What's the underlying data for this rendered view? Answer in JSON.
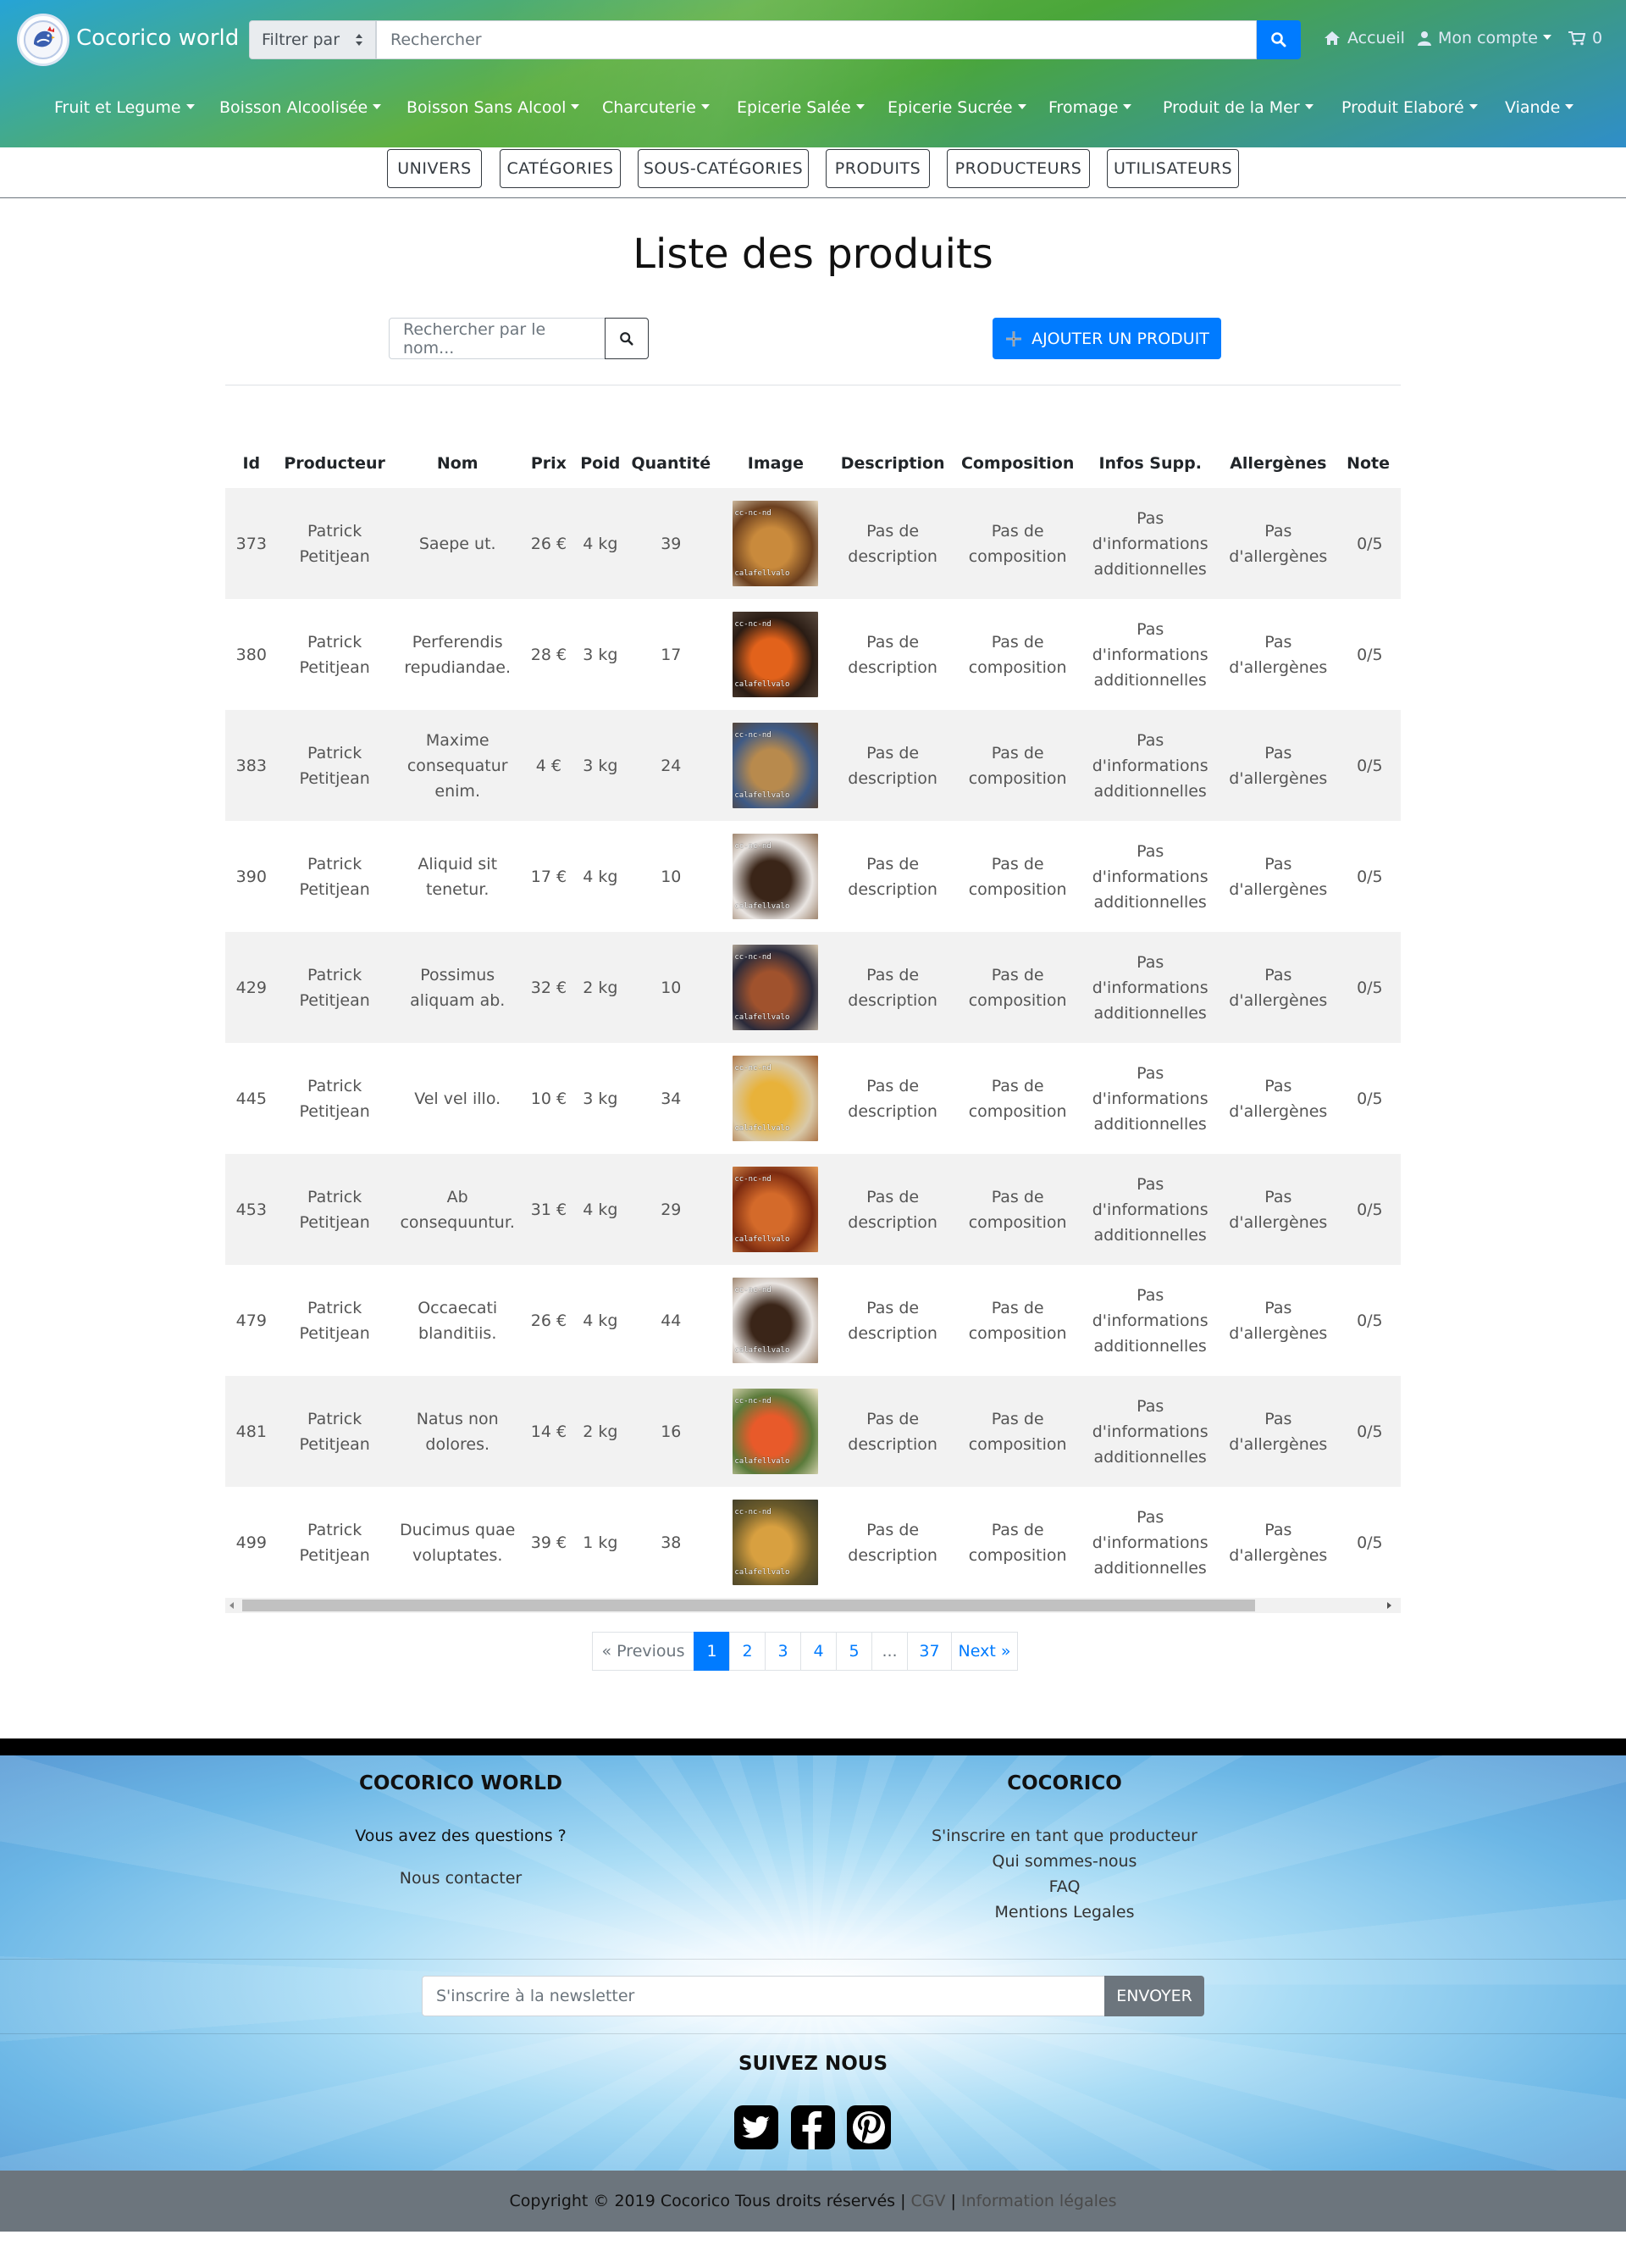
{
  "header": {
    "brand": "Cocorico world",
    "filter_label": "Filtrer par",
    "search_placeholder": "Rechercher",
    "home_label": "Accueil",
    "account_label": "Mon compte",
    "cart_count": "0",
    "categories": [
      "Fruit et Legume",
      "Boisson Alcoolisée",
      "Boisson Sans Alcool",
      "Charcuterie",
      "Epicerie Salée",
      "Epicerie Sucrée",
      "Fromage",
      "Produit de la Mer",
      "Produit Elaboré",
      "Viande"
    ]
  },
  "admin_nav": [
    "UNIVERS",
    "CATÉGORIES",
    "SOUS-CATÉGORIES",
    "PRODUITS",
    "PRODUCTEURS",
    "UTILISATEURS"
  ],
  "page": {
    "title": "Liste des produits",
    "name_search_placeholder": "Rechercher par le nom...",
    "add_button": "AJOUTER UN PRODUIT"
  },
  "table": {
    "columns": [
      "Id",
      "Producteur",
      "Nom",
      "Prix",
      "Poid",
      "Quantité",
      "Image",
      "Description",
      "Composition",
      "Infos Supp.",
      "Allergènes",
      "Note"
    ],
    "rows": [
      {
        "id": "373",
        "producer": "Patrick Petitjean",
        "name": "Saepe ut.",
        "price": "26 €",
        "weight": "4 kg",
        "qty": "39",
        "description": "Pas de description",
        "composition": "Pas de composition",
        "infos": "Pas d'informations additionnelles",
        "allergens": "Pas d'allergènes",
        "note": "0/5"
      },
      {
        "id": "380",
        "producer": "Patrick Petitjean",
        "name": "Perferendis repudiandae.",
        "price": "28 €",
        "weight": "3 kg",
        "qty": "17",
        "description": "Pas de description",
        "composition": "Pas de composition",
        "infos": "Pas d'informations additionnelles",
        "allergens": "Pas d'allergènes",
        "note": "0/5"
      },
      {
        "id": "383",
        "producer": "Patrick Petitjean",
        "name": "Maxime consequatur enim.",
        "price": "4 €",
        "weight": "3 kg",
        "qty": "24",
        "description": "Pas de description",
        "composition": "Pas de composition",
        "infos": "Pas d'informations additionnelles",
        "allergens": "Pas d'allergènes",
        "note": "0/5"
      },
      {
        "id": "390",
        "producer": "Patrick Petitjean",
        "name": "Aliquid sit tenetur.",
        "price": "17 €",
        "weight": "4 kg",
        "qty": "10",
        "description": "Pas de description",
        "composition": "Pas de composition",
        "infos": "Pas d'informations additionnelles",
        "allergens": "Pas d'allergènes",
        "note": "0/5"
      },
      {
        "id": "429",
        "producer": "Patrick Petitjean",
        "name": "Possimus aliquam ab.",
        "price": "32 €",
        "weight": "2 kg",
        "qty": "10",
        "description": "Pas de description",
        "composition": "Pas de composition",
        "infos": "Pas d'informations additionnelles",
        "allergens": "Pas d'allergènes",
        "note": "0/5"
      },
      {
        "id": "445",
        "producer": "Patrick Petitjean",
        "name": "Vel vel illo.",
        "price": "10 €",
        "weight": "3 kg",
        "qty": "34",
        "description": "Pas de description",
        "composition": "Pas de composition",
        "infos": "Pas d'informations additionnelles",
        "allergens": "Pas d'allergènes",
        "note": "0/5"
      },
      {
        "id": "453",
        "producer": "Patrick Petitjean",
        "name": "Ab consequuntur.",
        "price": "31 €",
        "weight": "4 kg",
        "qty": "29",
        "description": "Pas de description",
        "composition": "Pas de composition",
        "infos": "Pas d'informations additionnelles",
        "allergens": "Pas d'allergènes",
        "note": "0/5"
      },
      {
        "id": "479",
        "producer": "Patrick Petitjean",
        "name": "Occaecati blanditiis.",
        "price": "26 €",
        "weight": "4 kg",
        "qty": "44",
        "description": "Pas de description",
        "composition": "Pas de composition",
        "infos": "Pas d'informations additionnelles",
        "allergens": "Pas d'allergènes",
        "note": "0/5"
      },
      {
        "id": "481",
        "producer": "Patrick Petitjean",
        "name": "Natus non dolores.",
        "price": "14 €",
        "weight": "2 kg",
        "qty": "16",
        "description": "Pas de description",
        "composition": "Pas de composition",
        "infos": "Pas d'informations additionnelles",
        "allergens": "Pas d'allergènes",
        "note": "0/5"
      },
      {
        "id": "499",
        "producer": "Patrick Petitjean",
        "name": "Ducimus quae voluptates.",
        "price": "39 €",
        "weight": "1 kg",
        "qty": "38",
        "description": "Pas de description",
        "composition": "Pas de composition",
        "infos": "Pas d'informations additionnelles",
        "allergens": "Pas d'allergènes",
        "note": "0/5"
      }
    ],
    "image_watermark_top": "cc-nc-nd",
    "image_watermark_bottom": "calafellvalo"
  },
  "pagination": {
    "previous": "« Previous",
    "pages": [
      "1",
      "2",
      "3",
      "4",
      "5",
      "...",
      "37"
    ],
    "active": "1",
    "next": "Next »"
  },
  "footer": {
    "left_title": "COCORICO WORLD",
    "question": "Vous avez des questions ?",
    "contact": "Nous contacter",
    "right_title": "COCORICO",
    "links": [
      "S'inscrire en tant que producteur",
      "Qui sommes-nous",
      "FAQ",
      "Mentions Legales"
    ],
    "newsletter_placeholder": "S'inscrire à la newsletter",
    "send_label": "ENVOYER",
    "follow_title": "SUIVEZ NOUS",
    "copyright": "Copyright © 2019 Cocorico Tous droits réservés |",
    "cgv": "CGV",
    "sep": "|",
    "legal": "Information légales"
  },
  "colors": {
    "primary": "#007bff",
    "secondary": "#6c757d",
    "row_stripe": "#f2f2f2"
  }
}
